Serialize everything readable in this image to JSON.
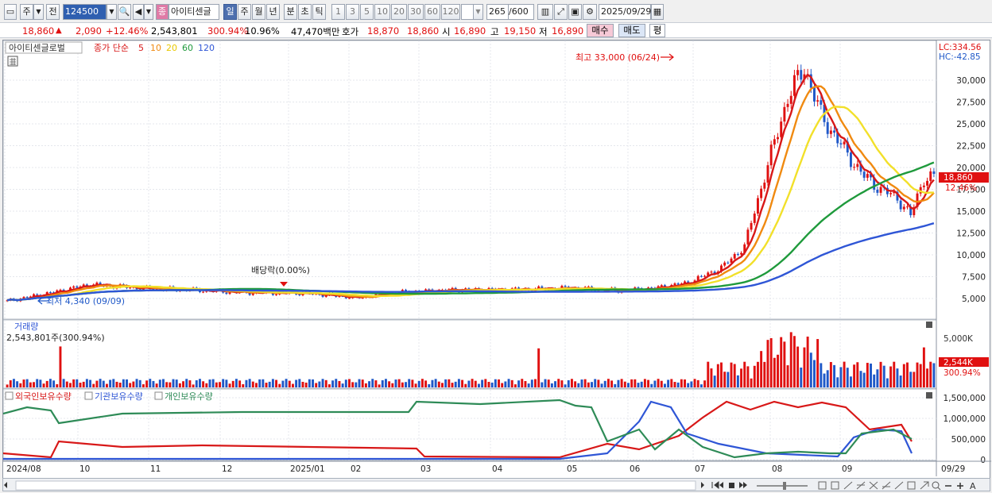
{
  "toolbar": {
    "market": "주",
    "prev_label": "전",
    "code": "124500",
    "badge": "종",
    "name": "아이티센글",
    "periods": [
      "일",
      "주",
      "월",
      "년",
      "분",
      "초",
      "틱"
    ],
    "active_period": "일",
    "intervals": [
      "1",
      "3",
      "5",
      "10",
      "20",
      "30",
      "60",
      "120"
    ],
    "count": "265",
    "count_total": "/600",
    "date": "2025/09/29"
  },
  "quote": {
    "price": "18,860",
    "arrow": "▲",
    "change": "2,090",
    "change_pct": "+12.46%",
    "volume": "2,543,801",
    "vol_ratio": "300.94%",
    "turnover": "10.96%",
    "amount": "47,470백만",
    "ask_label": "호가",
    "ask": "18,870",
    "bid": "18,860",
    "open_label": "시",
    "open": "16,890",
    "high_label": "고",
    "high": "19,150",
    "low_label": "저",
    "low": "16,890",
    "buy": "매수",
    "sell": "매도",
    "eval": "평"
  },
  "price_panel": {
    "legend": {
      "name": "아이티센글로벌",
      "ma_title": "종가 단순",
      "mas": [
        {
          "label": "5",
          "color": "#d81818"
        },
        {
          "label": "10",
          "color": "#f08a10"
        },
        {
          "label": "20",
          "color": "#f2e02a"
        },
        {
          "label": "60",
          "color": "#1f9a3c"
        },
        {
          "label": "120",
          "color": "#2f56d6"
        }
      ]
    },
    "lc": "LC:334.56",
    "hc": "HC:-42.85",
    "axis": [
      "30,000",
      "27,500",
      "25,000",
      "22,500",
      "20,000",
      "17,500",
      "15,000",
      "12,500",
      "10,000",
      "7,500",
      "5,000"
    ],
    "current_price": "18,860",
    "current_pct": "12.46%",
    "high_note": "최고 33,000 (06/24)",
    "low_note": "최저 4,340 (09/09)",
    "dividend_note": "배당락(0.00%)"
  },
  "volume_panel": {
    "title": "거래량",
    "value": "2,543,801주(300.94%)",
    "axis": [
      "5,000K"
    ],
    "current": "2,544K",
    "current_pct": "300.94%"
  },
  "holding_panel": {
    "legends": [
      {
        "label": "외국인보유수량",
        "color": "#d81818"
      },
      {
        "label": "기관보유수량",
        "color": "#2f56d6"
      },
      {
        "label": "개인보유수량",
        "color": "#2e8b57"
      }
    ],
    "axis": [
      "1,500,000",
      "1,000,000",
      "500,000",
      "0"
    ]
  },
  "x_axis": [
    "2024/08",
    "10",
    "11",
    "12",
    "2025/01",
    "02",
    "03",
    "04",
    "05",
    "06",
    "07",
    "08",
    "09",
    "09/29"
  ],
  "colors": {
    "up": "#e01010",
    "down": "#1f58c8",
    "accent": "#2f5fb0"
  }
}
